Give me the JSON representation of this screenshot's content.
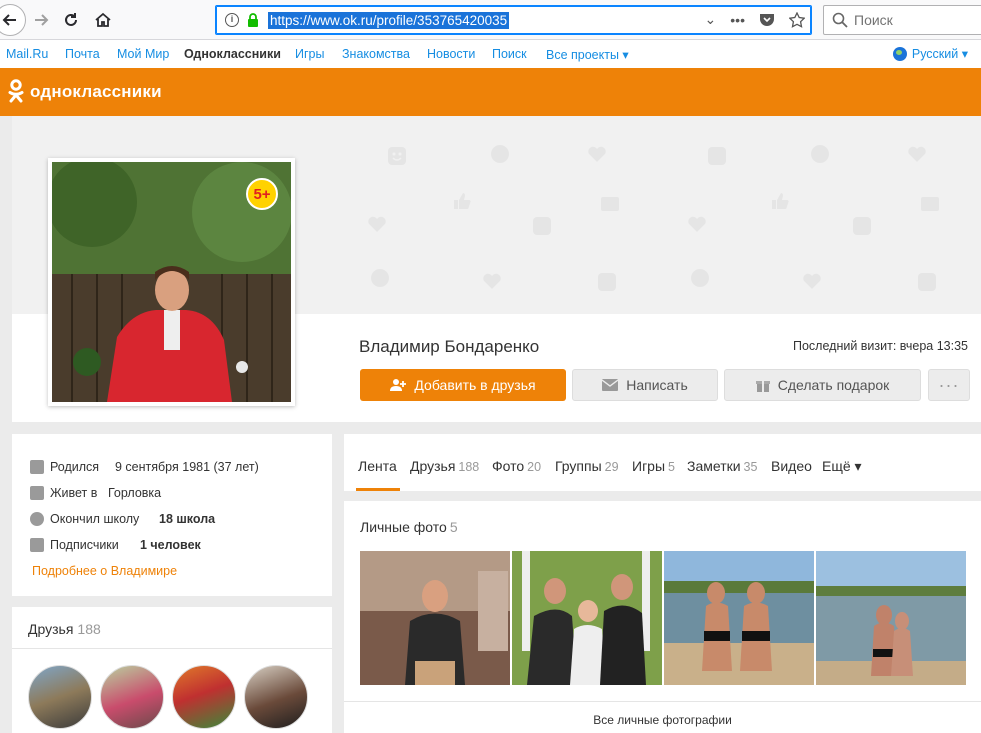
{
  "browser": {
    "url": "https://www.ok.ru/profile/353765420035",
    "search_placeholder": "Поиск",
    "more_dots": "•••"
  },
  "portal_nav": {
    "items": [
      {
        "label": "Mail.Ru",
        "active": false
      },
      {
        "label": "Почта",
        "active": false
      },
      {
        "label": "Мой Мир",
        "active": false
      },
      {
        "label": "Одноклассники",
        "active": true
      },
      {
        "label": "Игры",
        "active": false
      },
      {
        "label": "Знакомства",
        "active": false
      },
      {
        "label": "Новости",
        "active": false
      },
      {
        "label": "Поиск",
        "active": false
      },
      {
        "label": "Все проекты ▾",
        "active": false
      }
    ],
    "language": "Русский ▾"
  },
  "header": {
    "logo_text": "одноклассники",
    "accent_color": "#ee8208"
  },
  "profile": {
    "name": "Владимир Бондаренко",
    "last_visit": "Последний визит: вчера 13:35",
    "age_badge": "5+",
    "buttons": {
      "add_friend": "Добавить в друзья",
      "write": "Написать",
      "gift": "Сделать подарок",
      "more": "···"
    }
  },
  "info": {
    "rows": [
      {
        "icon": "calendar-icon",
        "label": "Родился",
        "value": "9 сентября 1981 (37 лет)"
      },
      {
        "icon": "building-icon",
        "label": "Живет в",
        "value": "Горловка"
      },
      {
        "icon": "graduation-icon",
        "label": "Окончил школу",
        "value": "18 школа"
      },
      {
        "icon": "rss-icon",
        "label": "Подписчики",
        "value": "1 человек"
      }
    ],
    "more_link": "Подробнее о Владимире"
  },
  "friends": {
    "title": "Друзья",
    "count": "188"
  },
  "tabs": [
    {
      "label": "Лента",
      "count": ""
    },
    {
      "label": "Друзья",
      "count": "188"
    },
    {
      "label": "Фото",
      "count": "20"
    },
    {
      "label": "Группы",
      "count": "29"
    },
    {
      "label": "Игры",
      "count": "5"
    },
    {
      "label": "Заметки",
      "count": "35"
    },
    {
      "label": "Видео",
      "count": ""
    },
    {
      "label": "Ещё ▾",
      "count": ""
    }
  ],
  "photos": {
    "title": "Личные фото",
    "count": "5",
    "all_link": "Все личные фотографии"
  }
}
